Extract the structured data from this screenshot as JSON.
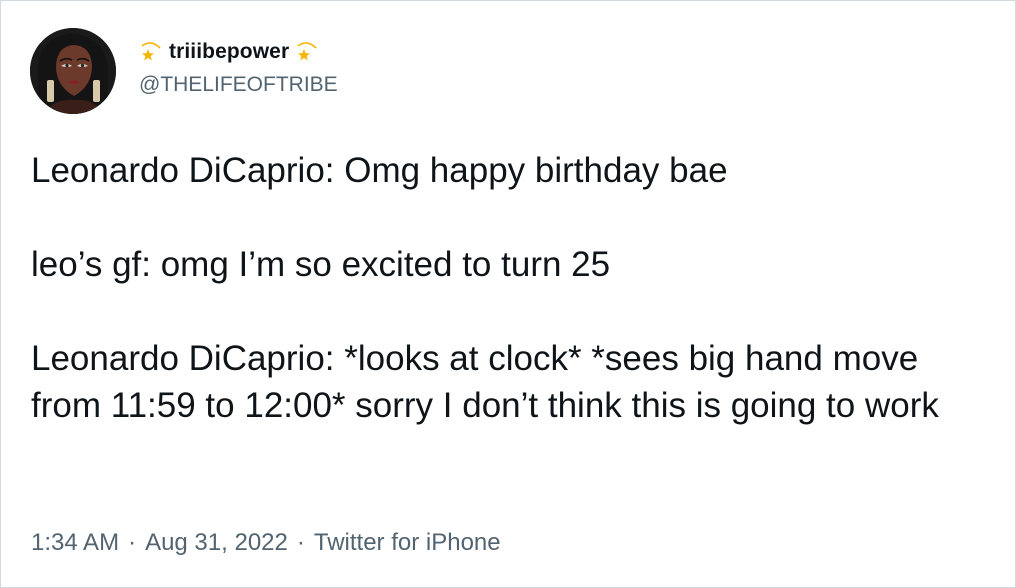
{
  "author": {
    "display_name": "triiibepower",
    "handle": "@THELIFEOFTRIBE",
    "name_emoji": "dizzy-star-icon"
  },
  "tweet": {
    "paragraphs": [
      "Leonardo DiCaprio: Omg happy birthday bae",
      "leo’s gf: omg I’m so excited to turn 25",
      "Leonardo DiCaprio: *looks at clock* *sees big hand move from 11:59 to 12:00* sorry I don’t think this is going to work"
    ]
  },
  "meta": {
    "time": "1:34 AM",
    "separator": "·",
    "date": "Aug 31, 2022",
    "source": "Twitter for iPhone"
  },
  "colors": {
    "text": "#0f1419",
    "secondary": "#536471",
    "border": "#cfd9de",
    "star": "#f4b400"
  }
}
